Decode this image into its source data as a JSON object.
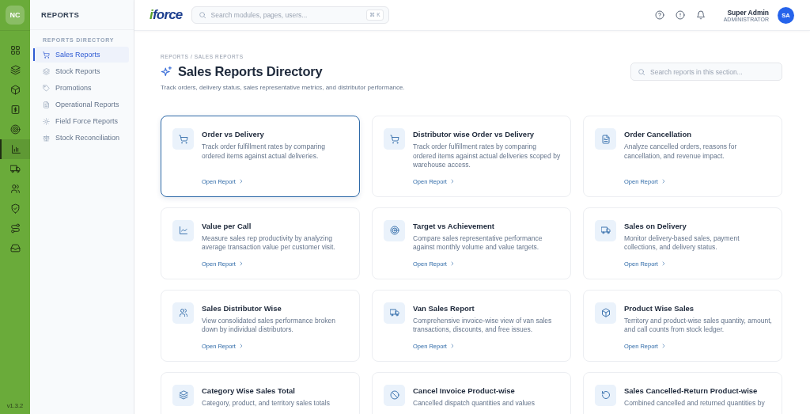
{
  "rail": {
    "badge": "NC",
    "items": [
      {
        "selected": false
      },
      {
        "selected": false
      },
      {
        "selected": false
      },
      {
        "selected": false
      },
      {
        "selected": false
      },
      {
        "selected": true
      },
      {
        "selected": false
      },
      {
        "selected": false
      },
      {
        "selected": false
      },
      {
        "selected": false
      },
      {
        "selected": false
      }
    ],
    "version": "v1.3.2"
  },
  "sidebar": {
    "title": "REPORTS",
    "section": "REPORTS DIRECTORY",
    "items": [
      {
        "label": "Sales Reports",
        "selected": true
      },
      {
        "label": "Stock Reports",
        "selected": false
      },
      {
        "label": "Promotions",
        "selected": false
      },
      {
        "label": "Operational Reports",
        "selected": false
      },
      {
        "label": "Field Force Reports",
        "selected": false
      },
      {
        "label": "Stock Reconciliation",
        "selected": false
      }
    ]
  },
  "topbar": {
    "logo": "iforce",
    "search": {
      "placeholder": "Search modules, pages, users...",
      "shortcut": "⌘ K"
    },
    "user": {
      "name": "Super Admin",
      "role": "ADMINISTRATOR",
      "initials": "SA"
    }
  },
  "page": {
    "breadcrumb": "REPORTS / SALES REPORTS",
    "title": "Sales Reports Directory",
    "subtitle": "Track orders, delivery status, sales representative metrics, and distributor performance.",
    "search": {
      "placeholder": "Search reports in this section..."
    }
  },
  "cards": [
    {
      "title": "Order vs Delivery",
      "description": "Track order fulfillment rates by comparing ordered items against actual deliveries.",
      "link": "Open Report",
      "selected": true
    },
    {
      "title": "Distributor wise Order vs Delivery",
      "description": "Track order fulfillment rates by comparing ordered items against actual deliveries scoped by warehouse access.",
      "link": "Open Report",
      "selected": false
    },
    {
      "title": "Order Cancellation",
      "description": "Analyze cancelled orders, reasons for cancellation, and revenue impact.",
      "link": "Open Report",
      "selected": false
    },
    {
      "title": "Value per Call",
      "description": "Measure sales rep productivity by analyzing average transaction value per customer visit.",
      "link": "Open Report",
      "selected": false
    },
    {
      "title": "Target vs Achievement",
      "description": "Compare sales representative performance against monthly volume and value targets.",
      "link": "Open Report",
      "selected": false
    },
    {
      "title": "Sales on Delivery",
      "description": "Monitor delivery-based sales, payment collections, and delivery status.",
      "link": "Open Report",
      "selected": false
    },
    {
      "title": "Sales Distributor Wise",
      "description": "View consolidated sales performance broken down by individual distributors.",
      "link": "Open Report",
      "selected": false
    },
    {
      "title": "Van Sales Report",
      "description": "Comprehensive invoice-wise view of van sales transactions, discounts, and free issues.",
      "link": "Open Report",
      "selected": false
    },
    {
      "title": "Product Wise Sales",
      "description": "Territory and product-wise sales quantity, amount, and call counts from stock ledger.",
      "link": "Open Report",
      "selected": false
    },
    {
      "title": "Category Wise Sales Total",
      "description": "Category, product, and territory sales totals",
      "selected": false
    },
    {
      "title": "Cancel Invoice Product-wise",
      "description": "Cancelled dispatch quantities and values",
      "selected": false
    },
    {
      "title": "Sales Cancelled-Return Product-wise",
      "description": "Combined cancelled and returned quantities by",
      "selected": false
    }
  ]
}
